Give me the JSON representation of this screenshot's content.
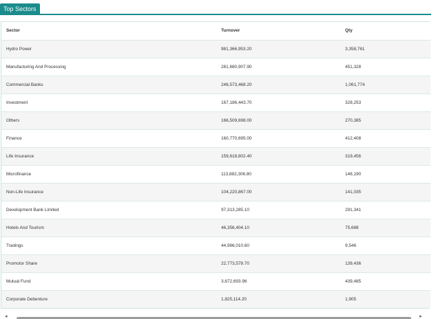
{
  "tab": {
    "label": "Top Sectors"
  },
  "table": {
    "headers": [
      "Sector",
      "Turnover",
      "Qty"
    ],
    "rows": [
      [
        "Hydro Power",
        "981,366,953.20",
        "3,358,761"
      ],
      [
        "Manufacturing And Processing",
        "281,680,907.90",
        "451,328"
      ],
      [
        "Commercial Banks",
        "246,573,468.20",
        "1,061,774"
      ],
      [
        "Investment",
        "167,186,443.70",
        "328,253"
      ],
      [
        "Others",
        "166,509,698.00",
        "270,385"
      ],
      [
        "Finance",
        "160,770,695.00",
        "412,408"
      ],
      [
        "Life Insurance",
        "159,618,802.40",
        "319,456"
      ],
      [
        "Microfinance",
        "113,882,306.80",
        "146,190"
      ],
      [
        "Non-Life Insurance",
        "104,220,867.00",
        "141,035"
      ],
      [
        "Development Bank Limited",
        "97,313,285.10",
        "291,341"
      ],
      [
        "Hotels And Tourism",
        "46,356,404.10",
        "75,688"
      ],
      [
        "Tradings",
        "44,986,010.60",
        "9,546"
      ],
      [
        "Promotor Share",
        "22,773,578.70",
        "139,436"
      ],
      [
        "Mutual Fund",
        "3,672,693.96",
        "439,485"
      ],
      [
        "Corporate Debenture",
        "1,825,114.20",
        "1,905"
      ]
    ]
  },
  "scrollbar": {
    "left_arrow": "◂",
    "right_arrow": "▸"
  }
}
